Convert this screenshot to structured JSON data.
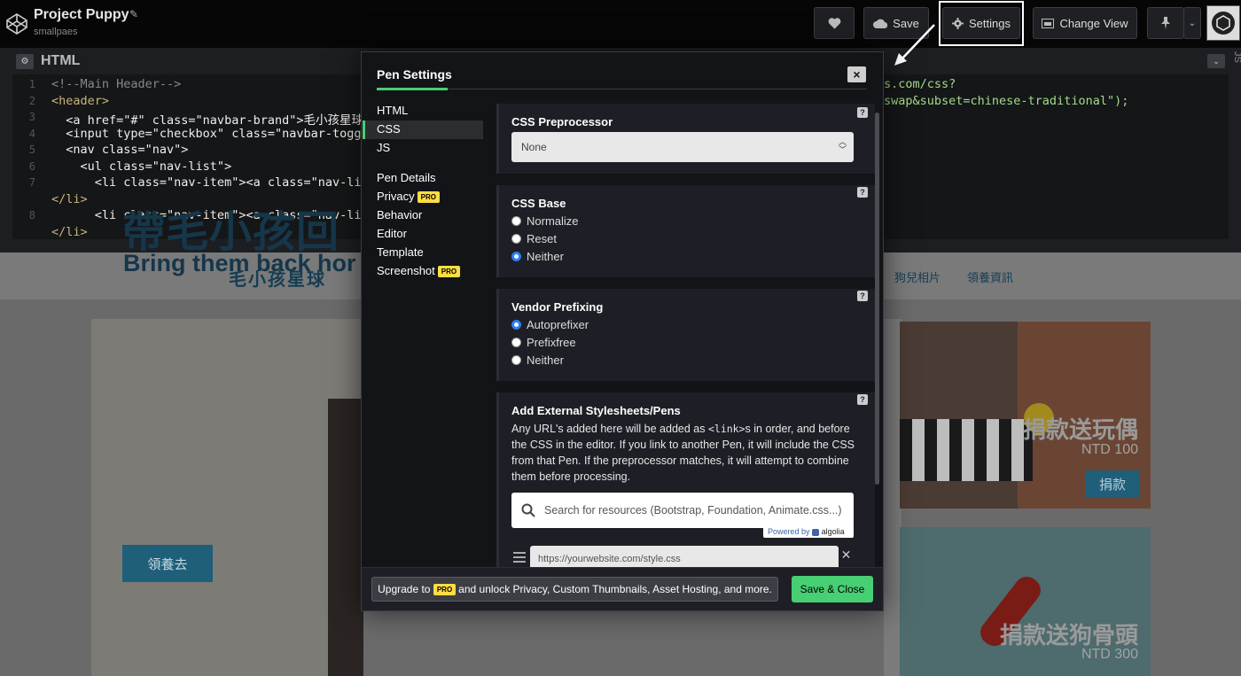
{
  "header": {
    "project_title": "Project Puppy",
    "username": "smallpaes",
    "buttons": {
      "save": "Save",
      "settings": "Settings",
      "change_view": "Change View"
    }
  },
  "editor": {
    "title": "HTML",
    "side_label": "JS",
    "gutter": [
      "1",
      "2",
      "3",
      "4",
      "5",
      "6",
      "7",
      "",
      "8",
      ""
    ],
    "lines": [
      "<!--Main Header-->",
      "<header>",
      "  <a href=\"#\" class=\"navbar-brand\">毛小孩星球</",
      "  <input type=\"checkbox\" class=\"navbar-toggle",
      "  <nav class=\"nav\">",
      "    <ul class=\"nav-list\">",
      "      <li class=\"nav-item\"><a class=\"nav-link\"",
      "</li>",
      "      <li class=\"nav-item\"><a class=\"nav-link\"",
      "</li>"
    ],
    "right_lines": [
      "s.com/css?",
      "swap&subset=chinese-traditional\");"
    ]
  },
  "preview": {
    "brand": "毛小孩星球",
    "nav_links": [
      "狗兒相片",
      "領養資訊"
    ],
    "hero_title": "帶毛小孩回",
    "hero_subtitle": "Bring them back hor",
    "adopt_button": "領養去",
    "card1_title": "捐款送玩偶",
    "card1_price": "NTD 100",
    "card1_button": "捐款",
    "card2_title": "捐款送狗骨頭",
    "card2_price": "NTD 300"
  },
  "modal": {
    "title": "Pen Settings",
    "close": "×",
    "nav": {
      "html": "HTML",
      "css": "CSS",
      "js": "JS",
      "pen_details": "Pen Details",
      "privacy": "Privacy",
      "behavior": "Behavior",
      "editor": "Editor",
      "template": "Template",
      "screenshot": "Screenshot",
      "pro_badge": "PRO"
    },
    "help": "?",
    "preprocessor": {
      "title": "CSS Preprocessor",
      "selected": "None"
    },
    "base": {
      "title": "CSS Base",
      "options": [
        "Normalize",
        "Reset",
        "Neither"
      ],
      "selected": "Neither"
    },
    "prefixing": {
      "title": "Vendor Prefixing",
      "options": [
        "Autoprefixer",
        "Prefixfree",
        "Neither"
      ],
      "selected": "Autoprefixer"
    },
    "external": {
      "title": "Add External Stylesheets/Pens",
      "desc_1": "Any URL's added here will be added as ",
      "desc_code": "<link>",
      "desc_2": "s in order, and before the CSS in the editor. If you link to another Pen, it will include the CSS from that Pen. If the preprocessor matches, it will attempt to combine them before processing.",
      "search_placeholder": "Search for resources (Bootstrap, Foundation, Animate.css...)",
      "powered_by": "Powered by",
      "algolia": "algolia",
      "url_placeholder": "https://yourwebsite.com/style.css"
    },
    "footer": {
      "upgrade_1": "Upgrade to",
      "upgrade_2": "and unlock Privacy, Custom Thumbnails, Asset Hosting, and more.",
      "save_close": "Save & Close"
    }
  },
  "colors": {
    "accent_green": "#47cf73",
    "pro_yellow": "#ffdd40",
    "radio_blue": "#2e7ef2"
  }
}
